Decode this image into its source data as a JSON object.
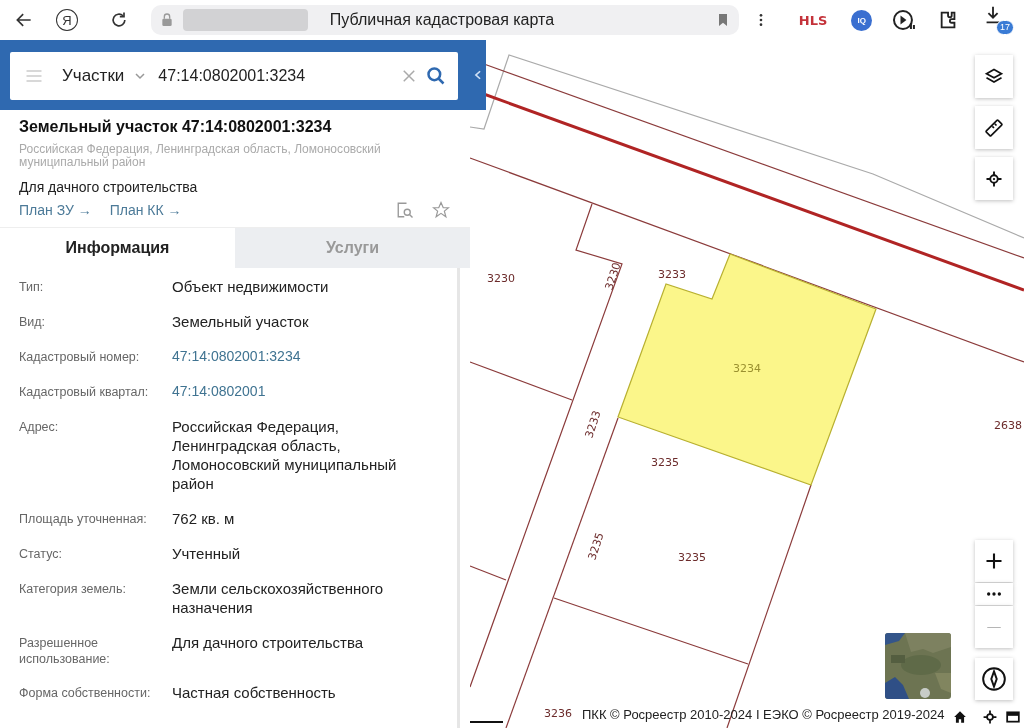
{
  "browser": {
    "logo": "Я",
    "title": "Публичная кадастровая карта",
    "extensions": [
      {
        "kind": "hls",
        "text": "HLS"
      },
      {
        "kind": "iq",
        "text": "IQ"
      }
    ],
    "downloads_badge": "17"
  },
  "search": {
    "layer": "Участки",
    "value": "47:14:0802001:3234"
  },
  "card": {
    "title": "Земельный участок 47:14:0802001:3234",
    "address": "Российская Федерация, Ленинградская область, Ломоносовский муниципальный район",
    "purpose": "Для дачного строительства",
    "links": [
      "План ЗУ →",
      "План КК →"
    ]
  },
  "tabs": [
    {
      "label": "Информация",
      "selected": true
    },
    {
      "label": "Услуги",
      "selected": false
    }
  ],
  "rows": [
    {
      "label": "Тип:",
      "value": "Объект недвижимости",
      "kind": "text"
    },
    {
      "label": "Вид:",
      "value": "Земельный участок",
      "kind": "text"
    },
    {
      "label": "Кадастровый номер:",
      "value": "47:14:0802001:3234",
      "kind": "link"
    },
    {
      "label": "Кадастровый квартал:",
      "value": "47:14:0802001",
      "kind": "link"
    },
    {
      "label": "Адрес:",
      "value": "Российская Федерация, Ленинградская область, Ломоносовский муниципальный район",
      "kind": "text"
    },
    {
      "label": "Площадь уточненная:",
      "value": "762 кв. м",
      "kind": "text"
    },
    {
      "label": "Статус:",
      "value": "Учтенный",
      "kind": "text"
    },
    {
      "label": "Категория земель:",
      "value": "Земли сельскохозяйственного назначения",
      "kind": "text"
    },
    {
      "label": "Разрешенное использование:",
      "value": "Для дачного строительства",
      "kind": "text"
    },
    {
      "label": "Форма собственности:",
      "value": "Частная собственность",
      "kind": "text"
    }
  ],
  "map": {
    "parcel_labels": [
      {
        "text": "3230",
        "selected": false
      },
      {
        "text": "3230",
        "selected": false
      },
      {
        "text": "3233",
        "selected": false
      },
      {
        "text": "3234",
        "selected": true
      },
      {
        "text": "2638",
        "selected": false
      },
      {
        "text": "3233",
        "selected": false
      },
      {
        "text": "3235",
        "selected": false
      },
      {
        "text": "3235",
        "selected": false
      },
      {
        "text": "3235",
        "selected": false
      },
      {
        "text": "3236",
        "selected": false
      }
    ],
    "attribution": "ПКК © Росреестр 2010-2024 I ЕЭКО © Росреестр 2019-2024"
  }
}
